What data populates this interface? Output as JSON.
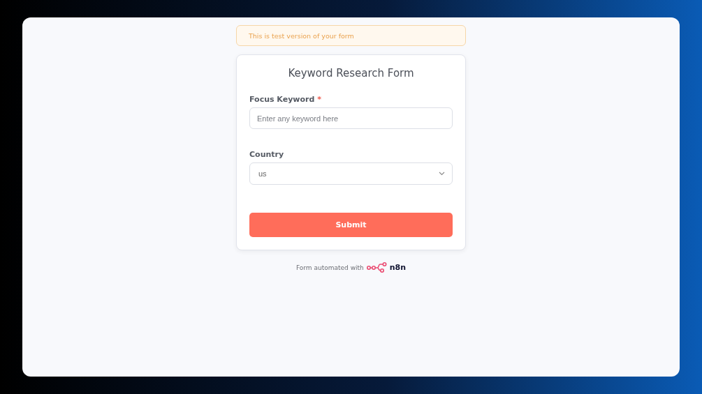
{
  "banner": {
    "text": "This is test version of your form"
  },
  "form": {
    "title": "Keyword Research Form",
    "fields": [
      {
        "kind": "text",
        "label": "Focus Keyword",
        "required_mark": "*",
        "placeholder": "Enter any keyword here"
      },
      {
        "kind": "select",
        "label": "Country",
        "value": "us"
      }
    ],
    "submit": "Submit"
  },
  "footer": {
    "text": "Form automated with",
    "brand": "n8n"
  }
}
